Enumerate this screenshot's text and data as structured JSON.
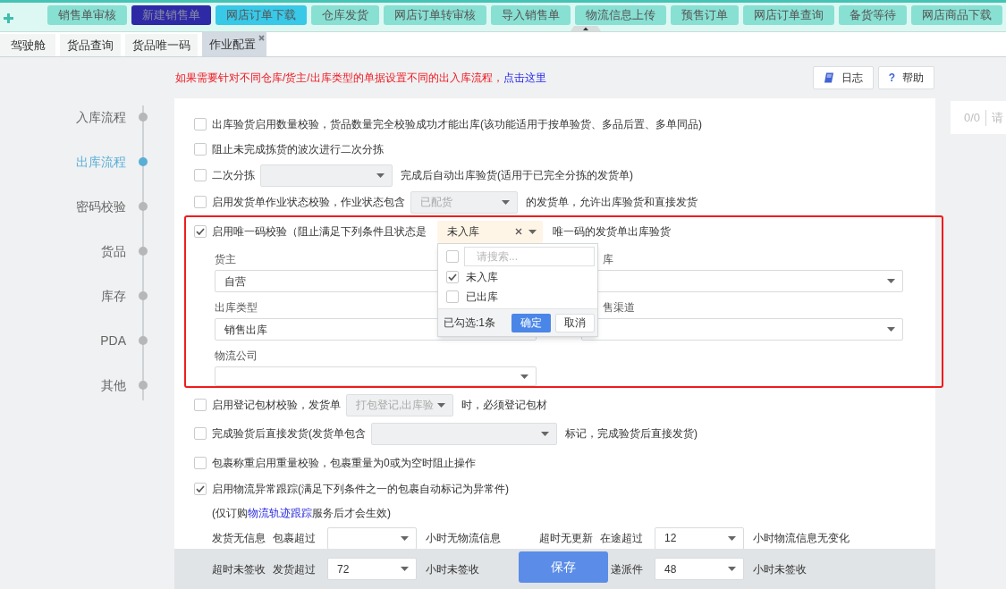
{
  "toolbar": {
    "buttons": [
      {
        "label": "销售单审核",
        "color": "#88e0d3"
      },
      {
        "label": "新建销售单",
        "color": "#2e2aa6"
      },
      {
        "label": "网店订单下载",
        "color": "#38c8e8"
      },
      {
        "label": "仓库发货",
        "color": "#88e0d3"
      },
      {
        "label": "网店订单转审核",
        "color": "#88e0d3"
      },
      {
        "label": "导入销售单",
        "color": "#88e0d3"
      },
      {
        "label": "物流信息上传",
        "color": "#88e0d3"
      },
      {
        "label": "预售订单",
        "color": "#88e0d3"
      },
      {
        "label": "网店订单查询",
        "color": "#88e0d3"
      },
      {
        "label": "备货等待",
        "color": "#88e0d3"
      },
      {
        "label": "网店商品下载",
        "color": "#88e0d3"
      }
    ]
  },
  "tabs": [
    {
      "label": "驾驶舱",
      "selected": false,
      "closable": false
    },
    {
      "label": "货品查询",
      "selected": false,
      "closable": false
    },
    {
      "label": "货品唯一码",
      "selected": false,
      "closable": false
    },
    {
      "label": "作业配置",
      "selected": true,
      "closable": true
    }
  ],
  "notice": {
    "text": "如果需要针对不同仓库/货主/出库类型的单据设置不同的出入库流程，",
    "link": "点击这里"
  },
  "header_buttons": [
    {
      "label": "日志"
    },
    {
      "label": "帮助",
      "glyph": "?"
    }
  ],
  "sidebar": {
    "items": [
      {
        "label": "入库流程",
        "selected": false
      },
      {
        "label": "出库流程",
        "selected": true
      },
      {
        "label": "密码校验",
        "selected": false
      },
      {
        "label": "货品",
        "selected": false
      },
      {
        "label": "库存",
        "selected": false
      },
      {
        "label": "PDA",
        "selected": false
      },
      {
        "label": "其他",
        "selected": false
      }
    ]
  },
  "options": [
    {
      "checked": false,
      "parts": [
        {
          "kind": "text",
          "text": "出库验货启用数量校验，货品数量完全校验成功才能出库(该功能适用于按单验货、多品后置、多单同品)"
        }
      ]
    },
    {
      "checked": false,
      "parts": [
        {
          "kind": "text",
          "text": "阻止未完成拣货的波次进行二次分拣"
        }
      ]
    },
    {
      "checked": false,
      "parts": [
        {
          "kind": "text",
          "text": "二次分拣"
        },
        {
          "kind": "select",
          "disabled": true
        },
        {
          "kind": "text",
          "text": "完成后自动出库验货(适用于已完全分拣的发货单)"
        }
      ]
    },
    {
      "checked": false,
      "parts": [
        {
          "kind": "text",
          "text": "启用发货单作业状态校验，作业状态包含"
        },
        {
          "kind": "select",
          "value": "已配货",
          "disabled": true
        },
        {
          "kind": "text",
          "text": "的发货单，允许出库验货和直接发货"
        }
      ]
    }
  ],
  "unique_code": {
    "checked": true,
    "label": "启用唯一码校验（阻止满足下列条件且状态是",
    "status": {
      "value": "未入库",
      "open": true
    },
    "suffix": "唯一码的发货单出库验货",
    "fields": [
      {
        "label": "货主",
        "value": "自营"
      },
      {
        "label": "库"
      },
      {
        "label": "出库类型",
        "value": "销售出库"
      },
      {
        "label": "售渠道"
      },
      {
        "label": "物流公司"
      }
    ],
    "menu": {
      "select_all": false,
      "search_placeholder": "请搜索...",
      "options": [
        {
          "label": "未入库",
          "checked": true
        },
        {
          "label": "已出库",
          "checked": false
        }
      ],
      "summary": "已勾选:1条",
      "confirm": "确定",
      "cancel": "取消"
    }
  },
  "more_options": [
    {
      "checked": false,
      "parts": [
        {
          "kind": "text",
          "text": "启用登记包材校验，发货单"
        },
        {
          "kind": "select",
          "value": "打包登记,出库验",
          "disabled": true
        },
        {
          "kind": "text",
          "text": "时，必须登记包材"
        }
      ]
    },
    {
      "checked": false,
      "parts": [
        {
          "kind": "text",
          "text": "完成验货后直接发货(发货单包含"
        },
        {
          "kind": "select",
          "disabled": true
        },
        {
          "kind": "text",
          "text": "标记，完成验货后直接发货)"
        }
      ]
    },
    {
      "checked": false,
      "parts": [
        {
          "kind": "text",
          "text": "包裹称重启用重量校验，包裹重量为0或为空时阻止操作"
        }
      ]
    }
  ],
  "tracking": {
    "checked": true,
    "label": "启用物流异常跟踪(满足下列条件之一的包裹自动标记为异常件)",
    "note": {
      "text": "(仅订购",
      "link": "物流轨迹跟踪",
      "after": "服务后才会生效)"
    },
    "lines": [
      [
        {
          "title": "发货无信息",
          "prefix": "包裹超过",
          "suffix": "小时无物流信息"
        },
        {
          "title": "超时无更新",
          "prefix": "在途超过",
          "value": "12",
          "suffix": "小时物流信息无变化"
        }
      ],
      [
        {
          "title": "超时未签收",
          "prefix": "发货超过",
          "value": "72",
          "suffix": "小时未签收"
        },
        {
          "prefix": "递派件",
          "value": "48",
          "suffix": "小时未签收"
        }
      ]
    ]
  },
  "save_button": "保存",
  "side_panel": {
    "pager": "0/0",
    "search_placeholder": "请"
  }
}
